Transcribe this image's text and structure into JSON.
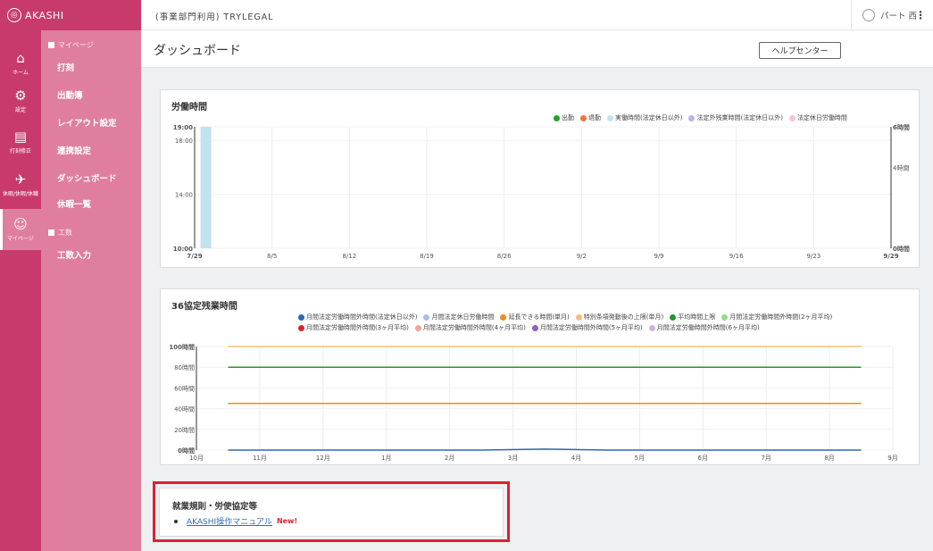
{
  "app": {
    "logo": "AKASHI",
    "company": "(事業部門利用) TRYLEGAL"
  },
  "user": {
    "name": "パート 西"
  },
  "rail": [
    {
      "label": "ホーム",
      "icon": "home-icon",
      "glyph": "⌂"
    },
    {
      "label": "設定",
      "icon": "gear-icon",
      "glyph": "⚙"
    },
    {
      "label": "打刻修正",
      "icon": "clipboard-icon",
      "glyph": "▤"
    },
    {
      "label": "休暇/休暇/休職",
      "icon": "plane-icon",
      "glyph": "✈"
    },
    {
      "label": "マイページ",
      "icon": "person-icon",
      "glyph": "☺"
    }
  ],
  "submenu": {
    "section1": "マイページ",
    "items1": [
      "打刻",
      "出勤簿",
      "レイアウト設定",
      "連携設定",
      "ダッシュボード",
      "休暇一覧"
    ],
    "section2": "工数",
    "items2": [
      "工数入力"
    ]
  },
  "page": {
    "title": "ダッシュボード",
    "help_button": "ヘルプセンター"
  },
  "labor": {
    "title": "労働時間",
    "legend": [
      {
        "label": "出勤",
        "color": "#21a32a"
      },
      {
        "label": "退勤",
        "color": "#f2733a"
      },
      {
        "label": "実働時間(法定休日以外)",
        "color": "#bfe4ef"
      },
      {
        "label": "法定外残業時間(法定休日以外)",
        "color": "#b9b4e6"
      },
      {
        "label": "法定休日労働時間",
        "color": "#f4c3e0"
      }
    ]
  },
  "overtime": {
    "title": "36協定残業時間",
    "legend": [
      {
        "label": "月間法定労働時間外時間(法定休日以外)",
        "color": "#2b6ab0"
      },
      {
        "label": "月間法定休日労働時間",
        "color": "#a9c1e4"
      },
      {
        "label": "延長できる時間(単月)",
        "color": "#f28a1c"
      },
      {
        "label": "特別条項発動後の上限(単月)",
        "color": "#f8bf7a"
      },
      {
        "label": "平均時間上限",
        "color": "#1f9a2e"
      },
      {
        "label": "月間法定労働時間外時間(2ヶ月平均)",
        "color": "#9ad88f"
      },
      {
        "label": "月間法定労働時間外時間(3ヶ月平均)",
        "color": "#d8262b"
      },
      {
        "label": "月間法定労働時間外時間(4ヶ月平均)",
        "color": "#f5a39a"
      },
      {
        "label": "月間法定労働時間外時間(5ヶ月平均)",
        "color": "#8f63b8"
      },
      {
        "label": "月間法定労働時間外時間(6ヶ月平均)",
        "color": "#c8b4dc"
      }
    ]
  },
  "rules": {
    "title": "就業規則・労使協定等",
    "link": "AKASHI操作マニュアル",
    "badge": "New!"
  },
  "chart_data": [
    {
      "type": "bar",
      "title": "労働時間",
      "x_ticks": [
        "7/29",
        "8/5",
        "8/12",
        "8/19",
        "8/26",
        "9/2",
        "9/9",
        "9/16",
        "9/23",
        "9/29"
      ],
      "y_ticks_left": [
        "10:00",
        "14:00",
        "18:00",
        "19:00"
      ],
      "y_ticks_right": [
        "0時間",
        "4時間",
        "6時間"
      ],
      "ylim": [
        10,
        19
      ],
      "y2lim": [
        0,
        6
      ],
      "series": [
        {
          "name": "実働時間(法定休日以外)",
          "bars": [
            {
              "x": "7/30",
              "start": 10,
              "end": 19
            }
          ]
        }
      ]
    },
    {
      "type": "line",
      "title": "36協定残業時間",
      "categories": [
        "10月",
        "11月",
        "12月",
        "1月",
        "2月",
        "3月",
        "4月",
        "5月",
        "6月",
        "7月",
        "8月",
        "9月"
      ],
      "y_ticks": [
        "0時間",
        "20時間",
        "40時間",
        "60時間",
        "80時間",
        "100時間"
      ],
      "ylim": [
        0,
        100
      ],
      "series": [
        {
          "name": "特別条項発動後の上限(単月)",
          "values": [
            100,
            100,
            100,
            100,
            100,
            100,
            100,
            100,
            100,
            100,
            100
          ]
        },
        {
          "name": "平均時間上限",
          "values": [
            80,
            80,
            80,
            80,
            80,
            80,
            80,
            80,
            80,
            80,
            80
          ]
        },
        {
          "name": "延長できる時間(単月)",
          "values": [
            45,
            45,
            45,
            45,
            45,
            45,
            45,
            45,
            45,
            45,
            45
          ]
        },
        {
          "name": "月間法定労働時間外時間(法定休日以外)",
          "values": [
            0,
            0,
            0,
            0,
            0,
            1,
            0,
            0,
            0,
            0,
            0
          ]
        }
      ]
    }
  ]
}
